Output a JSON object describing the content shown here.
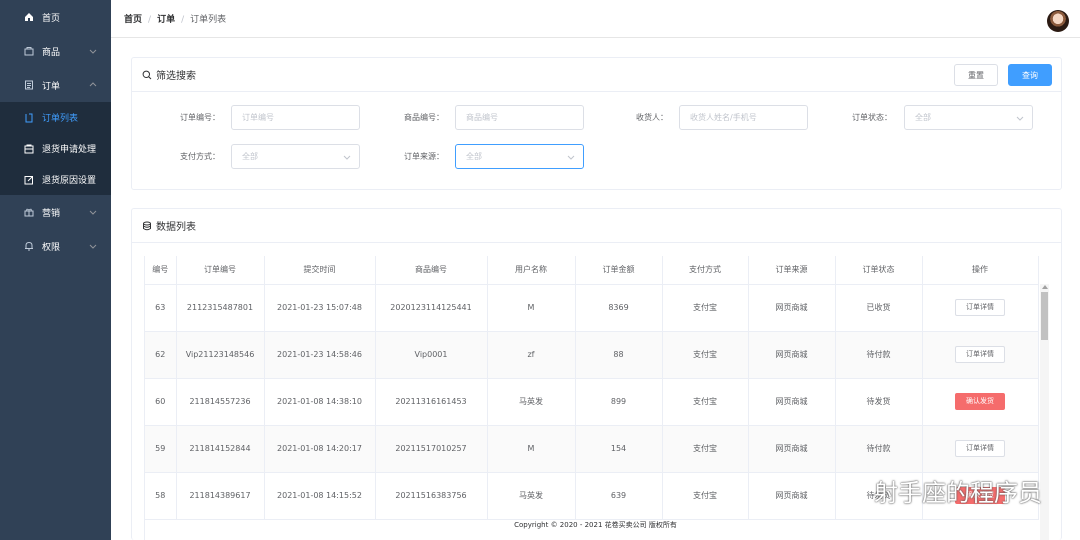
{
  "sidebar": {
    "items": [
      {
        "label": "首页",
        "icon": "home-icon"
      },
      {
        "label": "商品",
        "icon": "goods-icon"
      },
      {
        "label": "订单",
        "icon": "order-icon"
      }
    ],
    "order_sub": [
      {
        "label": "订单列表",
        "icon": "list-icon",
        "active": true
      },
      {
        "label": "退货申请处理",
        "icon": "return-apply-icon"
      },
      {
        "label": "退货原因设置",
        "icon": "edit-icon"
      }
    ],
    "bottom_items": [
      {
        "label": "营销",
        "icon": "gift-icon"
      },
      {
        "label": "权限",
        "icon": "bell-icon"
      }
    ]
  },
  "breadcrumb": {
    "home": "首页",
    "sep1": "/",
    "order": "订单",
    "sep2": "/",
    "current": "订单列表"
  },
  "filter": {
    "title": "筛选搜索",
    "reset_label": "重置",
    "query_label": "查询",
    "fields": {
      "order_no": {
        "label": "订单编号：",
        "placeholder": "订单编号"
      },
      "goods_no": {
        "label": "商品编号：",
        "placeholder": "商品编号"
      },
      "receiver": {
        "label": "收货人：",
        "placeholder": "收货人姓名/手机号"
      },
      "order_status": {
        "label": "订单状态：",
        "value": "全部"
      },
      "pay_method": {
        "label": "支付方式：",
        "value": "全部"
      },
      "order_source": {
        "label": "订单来源：",
        "value": "全部"
      }
    }
  },
  "list": {
    "title": "数据列表",
    "columns": [
      "编号",
      "订单编号",
      "提交时间",
      "商品编号",
      "用户名称",
      "订单金额",
      "支付方式",
      "订单来源",
      "订单状态",
      "操作"
    ],
    "rows": [
      {
        "id": "63",
        "order_no": "2112315487801",
        "time": "2021-01-23 15:07:48",
        "goods_no": "2020123114125441",
        "user": "M",
        "amount": "8369",
        "pay": "支付宝",
        "source": "网页商城",
        "status": "已收货",
        "action": "订单详情",
        "danger": false
      },
      {
        "id": "62",
        "order_no": "Vip21123148546",
        "time": "2021-01-23 14:58:46",
        "goods_no": "Vip0001",
        "user": "zf",
        "amount": "88",
        "pay": "支付宝",
        "source": "网页商城",
        "status": "待付款",
        "action": "订单详情",
        "danger": false
      },
      {
        "id": "60",
        "order_no": "211814557236",
        "time": "2021-01-08 14:38:10",
        "goods_no": "20211316161453",
        "user": "马英发",
        "amount": "899",
        "pay": "支付宝",
        "source": "网页商城",
        "status": "待发货",
        "action": "确认发货",
        "danger": true
      },
      {
        "id": "59",
        "order_no": "211814152844",
        "time": "2021-01-08 14:20:17",
        "goods_no": "20211517010257",
        "user": "M",
        "amount": "154",
        "pay": "支付宝",
        "source": "网页商城",
        "status": "待付款",
        "action": "订单详情",
        "danger": false
      },
      {
        "id": "58",
        "order_no": "211814389617",
        "time": "2021-01-08 14:15:52",
        "goods_no": "20211516383756",
        "user": "马英发",
        "amount": "639",
        "pay": "支付宝",
        "source": "网页商城",
        "status": "待发货",
        "action": "确认发货",
        "danger": true
      }
    ]
  },
  "footer": "Copyright © 2020 - 2021  花卷买卖公司 版权所有",
  "watermark": "射手座的程序员",
  "colors": {
    "sidebar_bg": "#304156",
    "submenu_bg": "#1f2d3d",
    "accent": "#409eff",
    "danger": "#f56c6c"
  }
}
